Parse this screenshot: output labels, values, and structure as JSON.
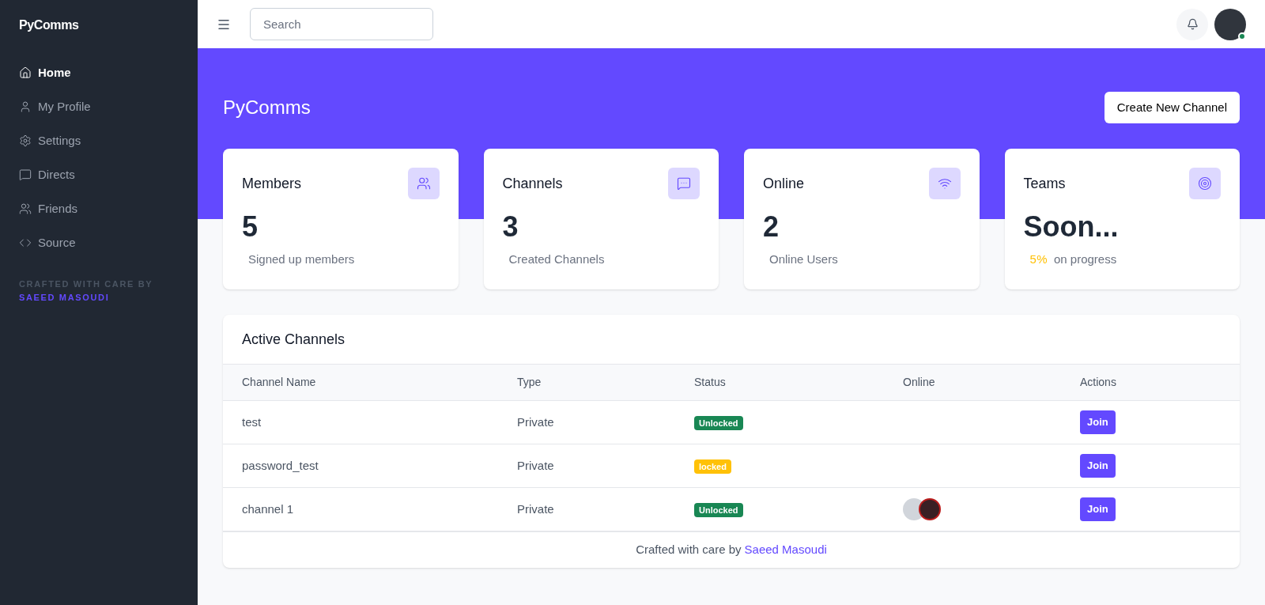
{
  "sidebar": {
    "brand": "PyComms",
    "items": [
      {
        "label": "Home",
        "selected": true
      },
      {
        "label": "My Profile",
        "selected": false
      },
      {
        "label": "Settings",
        "selected": false
      },
      {
        "label": "Directs",
        "selected": false
      },
      {
        "label": "Friends",
        "selected": false
      },
      {
        "label": "Source",
        "selected": false
      }
    ],
    "credit": {
      "text": "CRAFTED WITH CARE BY",
      "author": "SAEED MASOUDI"
    }
  },
  "topbar": {
    "search": {
      "placeholder": "Search"
    },
    "user": {
      "online": true
    }
  },
  "hero": {
    "title": "PyComms",
    "button": "Create New Channel"
  },
  "stats": [
    {
      "title": "Members",
      "value": "5",
      "caption": "Signed up members"
    },
    {
      "title": "Channels",
      "value": "3",
      "caption": "Created Channels"
    },
    {
      "title": "Online",
      "value": "2",
      "caption": "Online Users"
    },
    {
      "title": "Teams",
      "value": "Soon...",
      "highlight": "5%",
      "caption": "on progress"
    }
  ],
  "table": {
    "title": "Active Channels",
    "columns": [
      "Channel Name",
      "Type",
      "Status",
      "Online",
      "Actions"
    ],
    "rows": [
      {
        "name": "test",
        "type": "Private",
        "status": "Unlocked",
        "color": "#198754",
        "online": [],
        "action": "Join"
      },
      {
        "name": "password_test",
        "type": "Private",
        "status": "locked",
        "color": "#ffc107",
        "online": [],
        "action": "Join"
      },
      {
        "name": "channel 1",
        "type": "Private",
        "status": "Unlocked",
        "color": "#198754",
        "online": [
          {
            "kind": "light"
          },
          {
            "kind": "dark"
          }
        ],
        "action": "Join"
      }
    ],
    "footer": {
      "text": "Crafted with care by",
      "author": "Saeed Masoudi"
    }
  }
}
